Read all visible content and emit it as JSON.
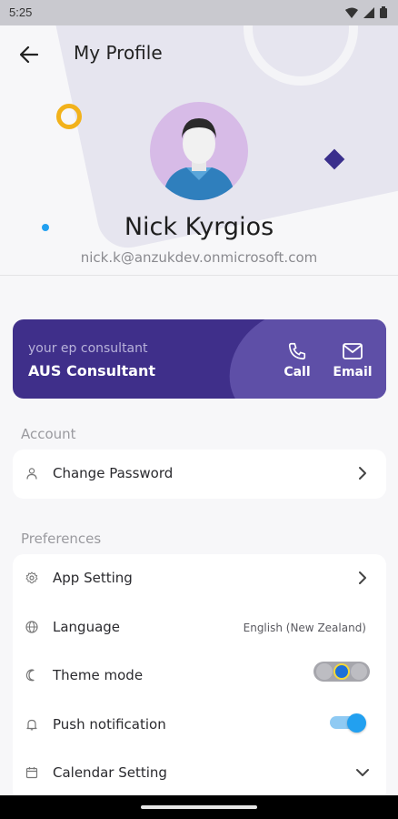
{
  "status_bar": {
    "time": "5:25",
    "icons": [
      "wifi-icon",
      "signal-icon",
      "battery-icon"
    ]
  },
  "header": {
    "back_icon": "arrow-left-icon",
    "title": "My Profile"
  },
  "profile": {
    "name": "Nick Kyrgios",
    "email": "nick.k@anzukdev.onmicrosoft.com"
  },
  "consultant_card": {
    "label": "your ep consultant",
    "name": "AUS Consultant",
    "call_label": "Call",
    "email_label": "Email",
    "colors": {
      "background": "#3f2f8a",
      "accent": "#5e4fa7"
    }
  },
  "sections": {
    "account": {
      "label": "Account",
      "items": [
        {
          "label": "Change Password",
          "icon": "person-icon",
          "control": "chevron-right-icon"
        }
      ]
    },
    "preferences": {
      "label": "Preferences",
      "items": [
        {
          "label": "App Setting",
          "icon": "gear-icon",
          "control": "chevron-right-icon"
        },
        {
          "label": "Language",
          "icon": "globe-icon",
          "value": "English (New Zealand)"
        },
        {
          "label": "Theme mode",
          "icon": "moon-icon",
          "control": "theme-toggle",
          "selected": "auto"
        },
        {
          "label": "Push notification",
          "icon": "bell-icon",
          "control": "switch",
          "enabled": true
        },
        {
          "label": "Calendar Setting",
          "icon": "calendar-icon",
          "control": "chevron-down-icon"
        }
      ]
    }
  },
  "colors": {
    "accent_blue": "#22a0f0",
    "deco_yellow": "#f2b21b",
    "deco_purple": "#3a2f8c"
  }
}
